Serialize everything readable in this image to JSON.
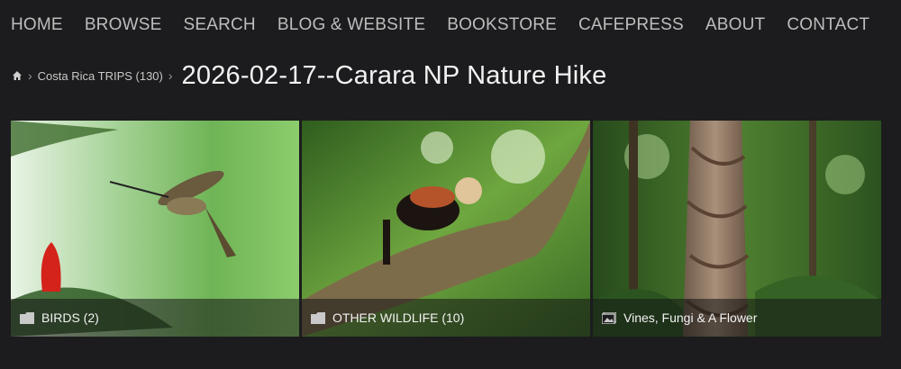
{
  "nav": {
    "items": [
      "HOME",
      "BROWSE",
      "SEARCH",
      "BLOG & WEBSITE",
      "BOOKSTORE",
      "CAFEPRESS",
      "ABOUT",
      "CONTACT"
    ]
  },
  "breadcrumb": {
    "parent": "Costa Rica TRIPS (130)",
    "separator": "›"
  },
  "page": {
    "title": "2026-02-17--Carara NP Nature Hike"
  },
  "gallery": {
    "tiles": [
      {
        "label": "BIRDS (2)",
        "icon": "folder-icon"
      },
      {
        "label": "OTHER WILDLIFE (10)",
        "icon": "folder-icon"
      },
      {
        "label": "Vines, Fungi & A Flower",
        "icon": "gallery-icon"
      }
    ]
  },
  "colors": {
    "background": "#1c1c1e",
    "nav_text": "#bdbdbd",
    "title": "#f2f2f2"
  }
}
